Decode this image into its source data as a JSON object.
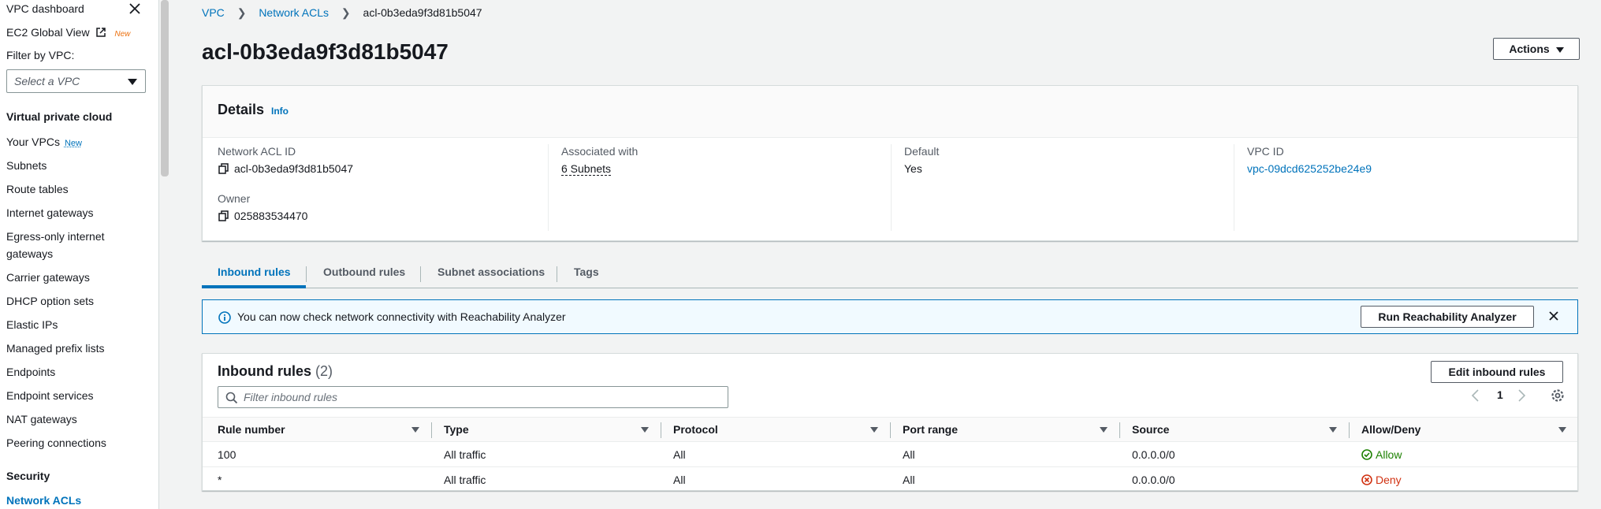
{
  "sidebar": {
    "vpc_dashboard": "VPC dashboard",
    "ec2_global_view": "EC2 Global View",
    "new_badge": "New",
    "filter_label": "Filter by VPC:",
    "filter_placeholder": "Select a VPC",
    "section_vpc": "Virtual private cloud",
    "items": [
      {
        "label": "Your VPCs",
        "badge": "New"
      },
      {
        "label": "Subnets"
      },
      {
        "label": "Route tables"
      },
      {
        "label": "Internet gateways"
      },
      {
        "label": "Egress-only internet"
      },
      {
        "label": "gateways"
      },
      {
        "label": "Carrier gateways"
      },
      {
        "label": "DHCP option sets"
      },
      {
        "label": "Elastic IPs"
      },
      {
        "label": "Managed prefix lists"
      },
      {
        "label": "Endpoints"
      },
      {
        "label": "Endpoint services"
      },
      {
        "label": "NAT gateways"
      },
      {
        "label": "Peering connections"
      }
    ],
    "section_security": "Security",
    "active_item": "Network ACLs"
  },
  "breadcrumb": {
    "items": [
      "VPC",
      "Network ACLs",
      "acl-0b3eda9f3d81b5047"
    ]
  },
  "page": {
    "title": "acl-0b3eda9f3d81b5047",
    "actions_label": "Actions"
  },
  "details": {
    "title": "Details",
    "info": "Info",
    "network_acl_id_label": "Network ACL ID",
    "network_acl_id": "acl-0b3eda9f3d81b5047",
    "owner_label": "Owner",
    "owner": "025883534470",
    "associated_label": "Associated with",
    "associated": "6 Subnets",
    "default_label": "Default",
    "default": "Yes",
    "vpc_id_label": "VPC ID",
    "vpc_id": "vpc-09dcd625252be24e9"
  },
  "tabs": [
    "Inbound rules",
    "Outbound rules",
    "Subnet associations",
    "Tags"
  ],
  "alert": {
    "text": "You can now check network connectivity with Reachability Analyzer",
    "button": "Run Reachability Analyzer"
  },
  "rules": {
    "title": "Inbound rules",
    "count": "(2)",
    "edit_button": "Edit inbound rules",
    "filter_placeholder": "Filter inbound rules",
    "page": "1",
    "columns": [
      "Rule number",
      "Type",
      "Protocol",
      "Port range",
      "Source",
      "Allow/Deny"
    ],
    "rows": [
      {
        "rule": "100",
        "type": "All traffic",
        "protocol": "All",
        "port": "All",
        "source": "0.0.0.0/0",
        "action": "Allow"
      },
      {
        "rule": "*",
        "type": "All traffic",
        "protocol": "All",
        "port": "All",
        "source": "0.0.0.0/0",
        "action": "Deny"
      }
    ]
  },
  "colors": {
    "link": "#0073bb",
    "allow": "#1d8102",
    "deny": "#d13212",
    "new_badge": "#ec7211"
  },
  "icons": [
    "close-icon",
    "external-link-icon",
    "caret-down-icon",
    "copy-icon",
    "info-circle-icon",
    "search-icon",
    "chevron-left-icon",
    "chevron-right-icon",
    "gear-icon",
    "check-circle-icon",
    "x-circle-icon"
  ]
}
